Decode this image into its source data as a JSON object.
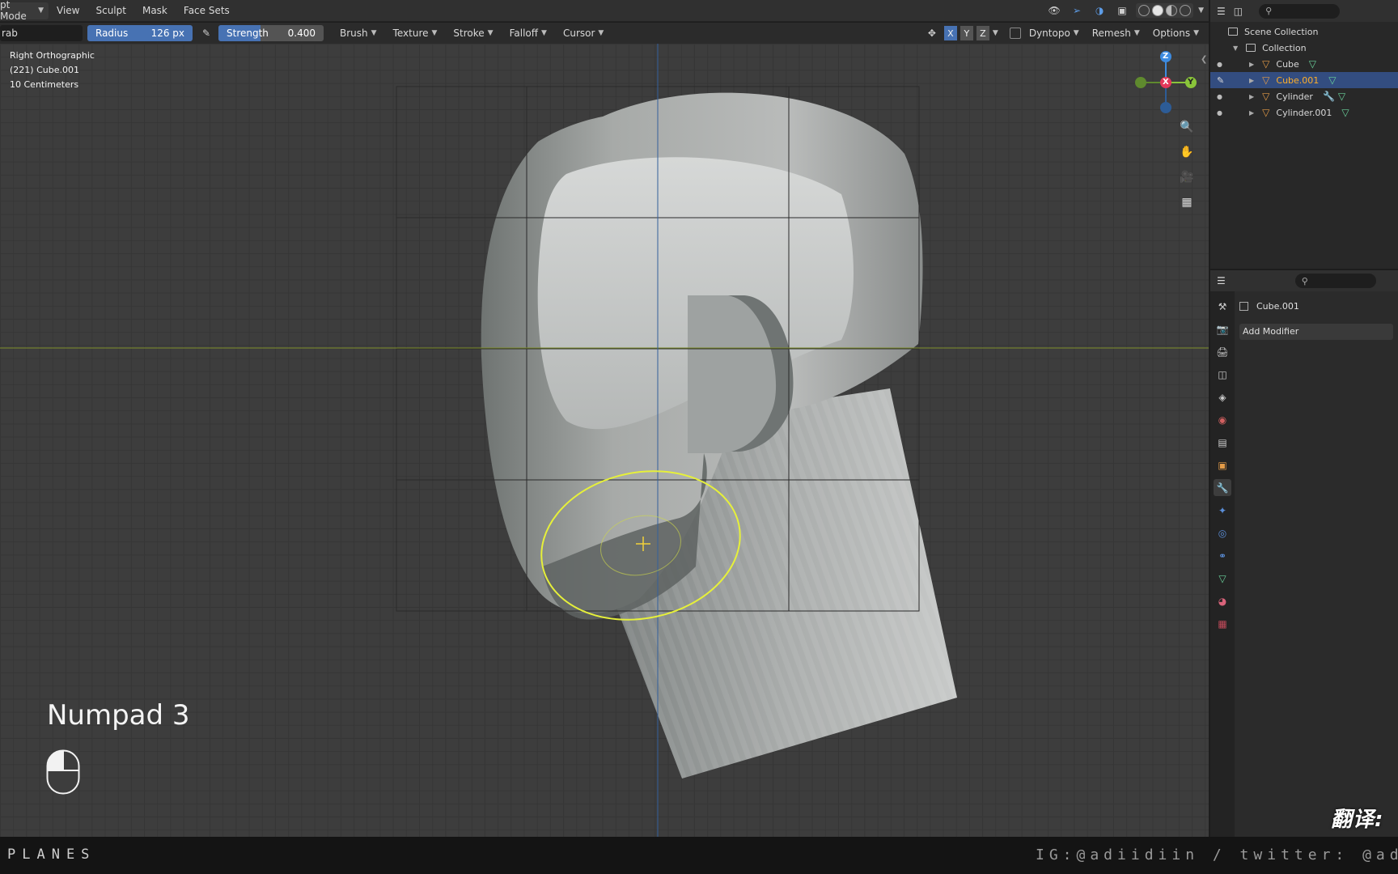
{
  "header": {
    "mode_label": "pt Mode",
    "menus": [
      "View",
      "Sculpt",
      "Mask",
      "Face Sets"
    ]
  },
  "tool_settings": {
    "brush_name": "rab",
    "radius_label": "Radius",
    "radius_value": "126 px",
    "strength_label": "Strength",
    "strength_value": "0.400",
    "strength_fraction": 0.4,
    "dropdowns": [
      "Brush",
      "Texture",
      "Stroke",
      "Falloff",
      "Cursor"
    ],
    "symmetry_axes": [
      "X",
      "Y",
      "Z"
    ],
    "dyntopo_label": "Dyntopo",
    "remesh_label": "Remesh",
    "options_label": "Options"
  },
  "viewport": {
    "view_name": "Right Orthographic",
    "object_info": "(221) Cube.001",
    "scale_info": "10 Centimeters",
    "gizmo_axes": [
      "Z",
      "X",
      "Y"
    ],
    "keycast": "Numpad 3"
  },
  "outliner": {
    "root": "Scene Collection",
    "collection": "Collection",
    "objects": [
      {
        "name": "Cube",
        "selected": false,
        "modifier": false
      },
      {
        "name": "Cube.001",
        "selected": true,
        "modifier": false
      },
      {
        "name": "Cylinder",
        "selected": false,
        "modifier": true
      },
      {
        "name": "Cylinder.001",
        "selected": false,
        "modifier": false
      }
    ]
  },
  "properties": {
    "object_name": "Cube.001",
    "add_modifier_label": "Add Modifier"
  },
  "footer": {
    "brand": "PLANES",
    "credit": "IG:@adiidiin / twitter: @adiid",
    "watermark": "翻译:"
  },
  "colors": {
    "accent_blue": "#4772b3",
    "selection_orange": "#ffaf29",
    "brush_circle": "#e6f03a",
    "axis_x": "#e3385a",
    "axis_y": "#8ac53a",
    "axis_z": "#3d8be0"
  }
}
